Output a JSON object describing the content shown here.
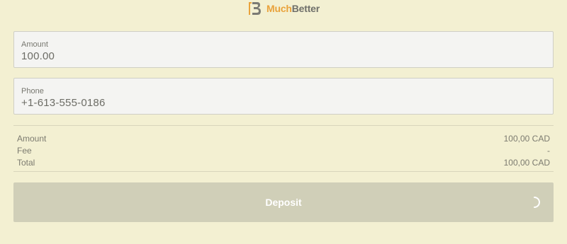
{
  "brand": {
    "name_part1": "Much",
    "name_part2": "Better",
    "logo_icon": "muchbetter-logo-icon",
    "accent_color": "#e9a23b"
  },
  "form": {
    "amount": {
      "label": "Amount",
      "value": "100.00"
    },
    "phone": {
      "label": "Phone",
      "value": "+1-613-555-0186"
    }
  },
  "summary": {
    "rows": [
      {
        "label": "Amount",
        "value": "100,00 CAD"
      },
      {
        "label": "Fee",
        "value": "-"
      },
      {
        "label": "Total",
        "value": "100,00 CAD"
      }
    ]
  },
  "deposit": {
    "label": "Deposit",
    "state": "loading",
    "spinner_icon": "loading-spinner-icon",
    "background_color": "#d0cfb8"
  },
  "theme": {
    "page_background": "#f3f0d2"
  }
}
